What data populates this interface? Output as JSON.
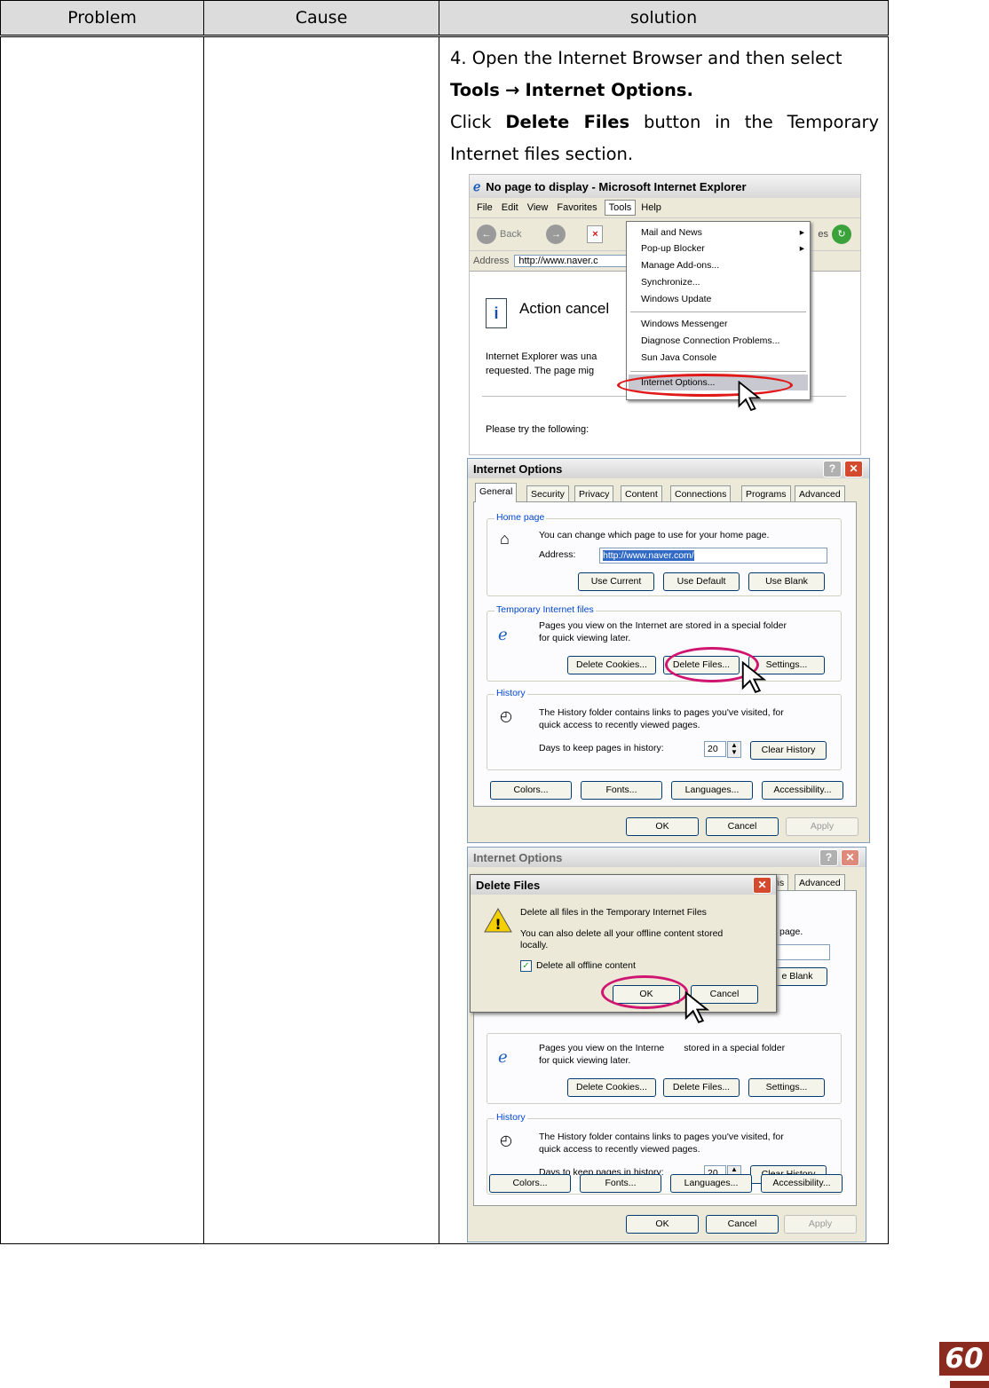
{
  "table": {
    "headers": [
      "Problem",
      "Cause",
      "solution"
    ]
  },
  "solution": {
    "step_line1": "4. Open the Internet Browser and then select",
    "step_tools": "Tools",
    "step_arrow": "→",
    "step_internet_options": "Internet Options.",
    "click_word": "Click",
    "delete_files_word": "Delete Files",
    "click_rest": "button in the Temporary Internet files section."
  },
  "ie_window": {
    "title": "No page to display - Microsoft Internet Explorer",
    "menu": [
      "File",
      "Edit",
      "View",
      "Favorites",
      "Tools",
      "Help"
    ],
    "back_label": "Back",
    "address_label": "Address",
    "address_value": "http://www.naver.c",
    "partial_right": "es",
    "page_heading": "Action cancel",
    "page_text_1": "Internet Explorer was una",
    "page_text_2": "requested. The page mig",
    "page_text_3": "Please try the following:",
    "tools_menu": [
      "Mail and News",
      "Pop-up Blocker",
      "Manage Add-ons...",
      "Synchronize...",
      "Windows Update",
      "Windows Messenger",
      "Diagnose Connection Problems...",
      "Sun Java Console",
      "Internet Options..."
    ]
  },
  "internet_options": {
    "title": "Internet Options",
    "help": "?",
    "close": "✕",
    "tabs": [
      "General",
      "Security",
      "Privacy",
      "Content",
      "Connections",
      "Programs",
      "Advanced"
    ],
    "home_group": "Home page",
    "home_text": "You can change which page to use for your home page.",
    "address_label": "Address:",
    "address_value": "http://www.naver.com/",
    "use_current": "Use Current",
    "use_default": "Use Default",
    "use_blank": "Use Blank",
    "temp_group": "Temporary Internet files",
    "temp_text_1": "Pages you view on the Internet are stored in a special folder",
    "temp_text_2": "for quick viewing later.",
    "delete_cookies": "Delete Cookies...",
    "delete_files": "Delete Files...",
    "settings": "Settings...",
    "history_group": "History",
    "history_text_1": "The History folder contains links to pages you've visited, for",
    "history_text_2": "quick access to recently viewed pages.",
    "days_label": "Days to keep pages in history:",
    "days_value": "20",
    "clear_history": "Clear History",
    "colors": "Colors...",
    "fonts": "Fonts...",
    "languages": "Languages...",
    "accessibility": "Accessibility...",
    "ok": "OK",
    "cancel": "Cancel",
    "apply": "Apply"
  },
  "delete_dialog": {
    "title": "Delete Files",
    "line1": "Delete all files in the Temporary Internet Files",
    "line2": "You can also delete all your offline content stored",
    "line3": "locally.",
    "checkbox_label": "Delete all offline content",
    "ok": "OK",
    "cancel": "Cancel",
    "behind_tabs_1": "ns",
    "behind_tabs_2": "Advanced",
    "behind_text": "page.",
    "behind_blank": "e Blank",
    "behind_temp": "stored in a special folder",
    "behind_temp_a": "Pages you view on the Interne"
  },
  "page_number": "60",
  "colors": {
    "highlight_ring": "#d01570",
    "menu_ring": "#e01818",
    "page_number_bg": "#8b2b20"
  }
}
